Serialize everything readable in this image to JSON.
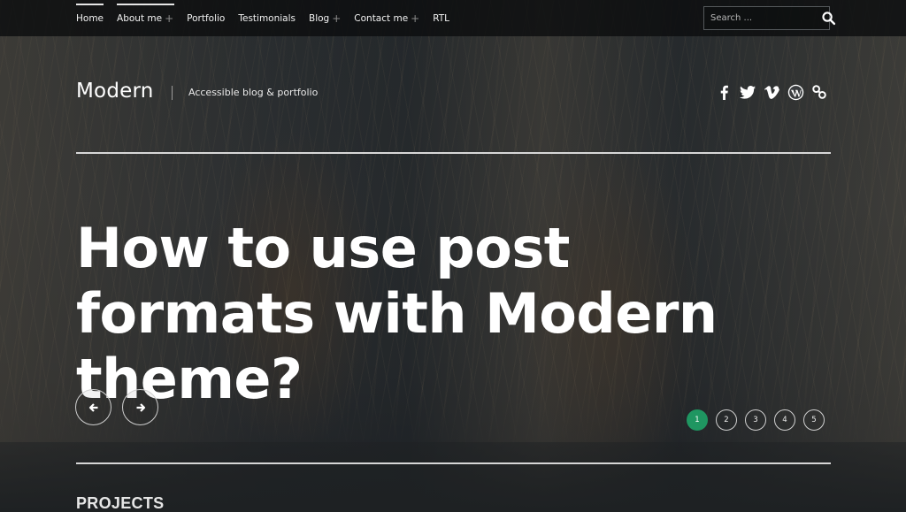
{
  "nav": {
    "items": [
      {
        "label": "Home",
        "has_submenu": false,
        "active": true
      },
      {
        "label": "About me",
        "has_submenu": true,
        "active": false
      },
      {
        "label": "Portfolio",
        "has_submenu": false,
        "active": false
      },
      {
        "label": "Testimonials",
        "has_submenu": false,
        "active": false
      },
      {
        "label": "Blog",
        "has_submenu": true,
        "active": false
      },
      {
        "label": "Contact me",
        "has_submenu": true,
        "active": false
      },
      {
        "label": "RTL",
        "has_submenu": false,
        "active": false
      }
    ],
    "submenu_indicator": "+"
  },
  "search": {
    "placeholder": "Search ...",
    "value": "",
    "icon": "search-icon"
  },
  "branding": {
    "site_title": "Modern",
    "tagline": "Accessible blog & portfolio"
  },
  "social": [
    "facebook-icon",
    "twitter-icon",
    "vimeo-icon",
    "wordpress-icon",
    "link-icon"
  ],
  "hero": {
    "headline": "How to use post formats with Modern theme?",
    "prev_icon": "arrow-left-icon",
    "next_icon": "arrow-right-icon"
  },
  "slider": {
    "pages": [
      "1",
      "2",
      "3",
      "4",
      "5"
    ],
    "current": 1,
    "active_color": "#1f9661"
  },
  "sections": {
    "projects_title": "PROJECTS"
  }
}
